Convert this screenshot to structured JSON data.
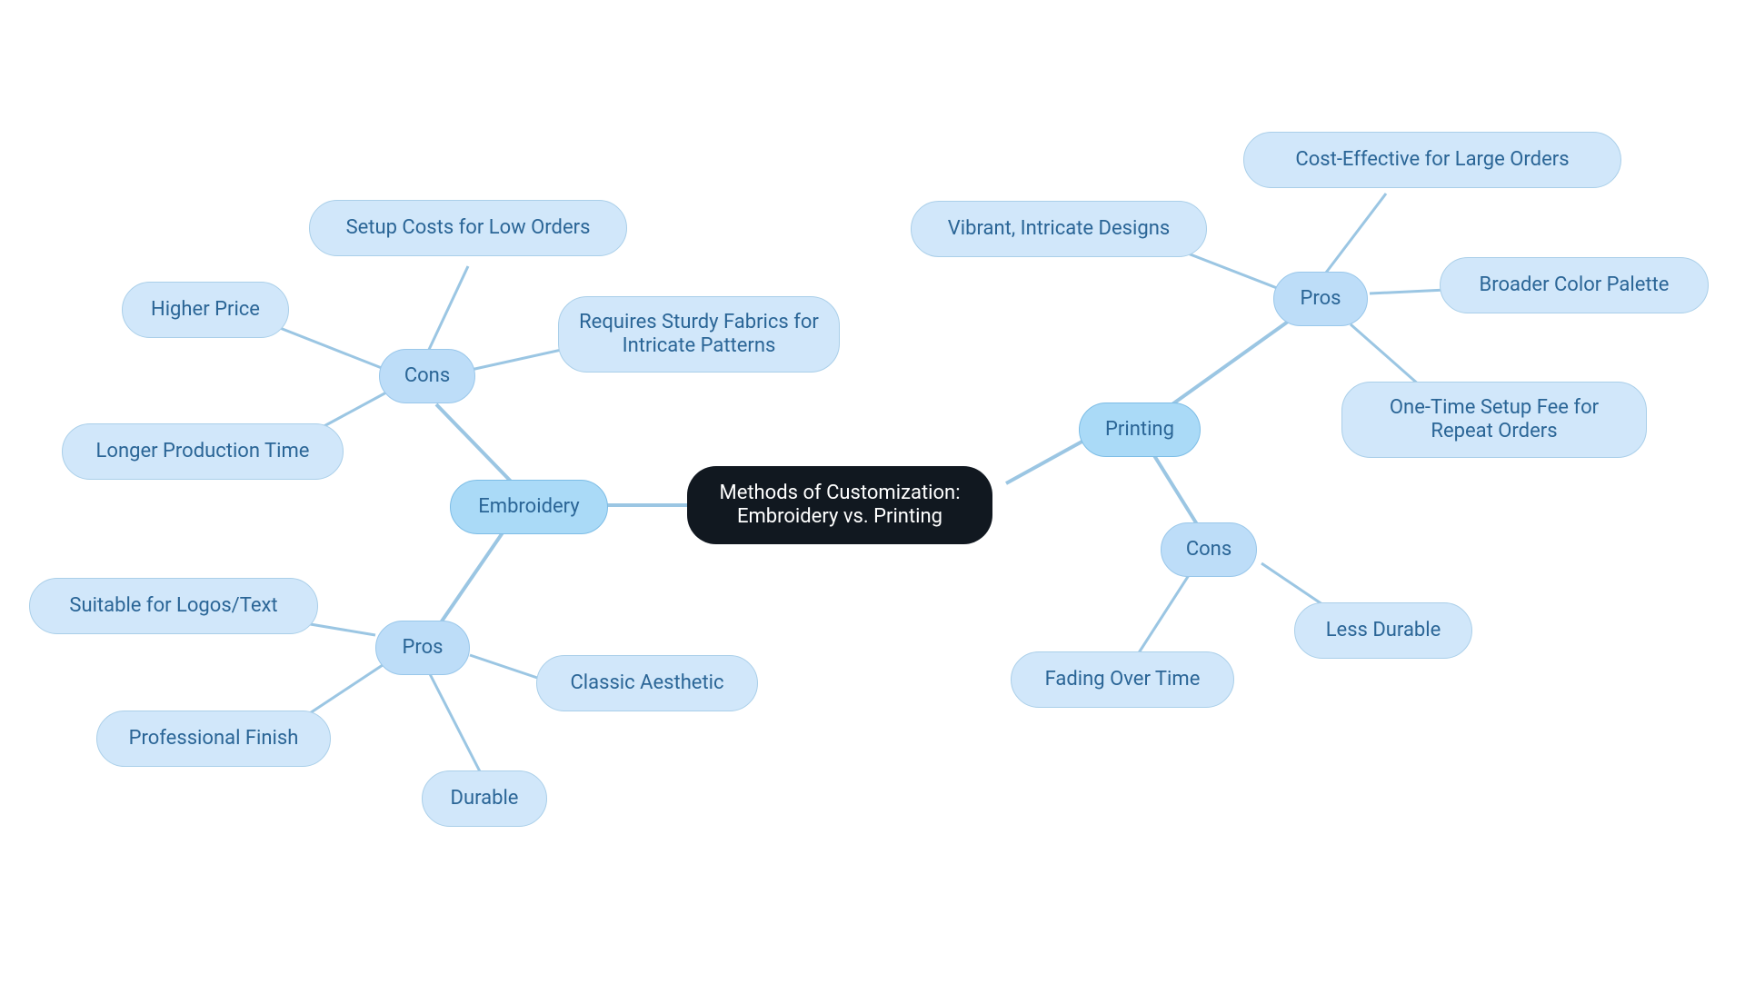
{
  "center": {
    "label": "Methods of Customization: Embroidery vs. Printing"
  },
  "embroidery": {
    "label": "Embroidery",
    "pros": {
      "label": "Pros",
      "items": {
        "logos": "Suitable for Logos/Text",
        "professional": "Professional Finish",
        "durable": "Durable",
        "classic": "Classic Aesthetic"
      }
    },
    "cons": {
      "label": "Cons",
      "items": {
        "price": "Higher Price",
        "time": "Longer Production Time",
        "setup": "Setup Costs for Low Orders",
        "fabrics": "Requires Sturdy Fabrics for Intricate Patterns"
      }
    }
  },
  "printing": {
    "label": "Printing",
    "pros": {
      "label": "Pros",
      "items": {
        "vibrant": "Vibrant, Intricate Designs",
        "cost": "Cost-Effective for Large Orders",
        "palette": "Broader Color Palette",
        "setup": "One-Time Setup Fee for Repeat Orders"
      }
    },
    "cons": {
      "label": "Cons",
      "items": {
        "lessdurable": "Less Durable",
        "fading": "Fading Over Time"
      }
    }
  }
}
